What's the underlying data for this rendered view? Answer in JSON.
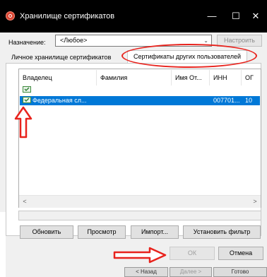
{
  "window": {
    "title": "Хранилище сертификатов",
    "min": "—",
    "max": "☐",
    "close": "✕"
  },
  "purpose": {
    "label": "Назначение:",
    "value": "<Любое>",
    "configure": "Настроить"
  },
  "tabs": [
    {
      "label": "Личное хранилище сертификатов"
    },
    {
      "label": "Сертификаты других пользователей"
    }
  ],
  "table": {
    "columns": [
      "Владелец",
      "Фамилия",
      "Имя От...",
      "ИНН",
      "ОГ"
    ],
    "rows": [
      {
        "owner": "",
        "surname": "",
        "name": "",
        "inn": "",
        "ogrn": ""
      },
      {
        "owner": "Федеральная сл...",
        "surname": "",
        "name": "",
        "inn": "007701...",
        "ogrn": "10"
      }
    ]
  },
  "scroll": {
    "left": "<",
    "right": ">"
  },
  "buttons": {
    "refresh": "Обновить",
    "view": "Просмотр",
    "import": "Импорт...",
    "filter": "Установить фильтр",
    "ok": "ОК",
    "cancel": "Отмена"
  },
  "wizard": {
    "back": "< Назад",
    "next": "Далее >",
    "done": "Готово"
  },
  "colors": {
    "selection": "#0078d7",
    "annotation": "#e8231d",
    "titlebar": "#000000"
  }
}
